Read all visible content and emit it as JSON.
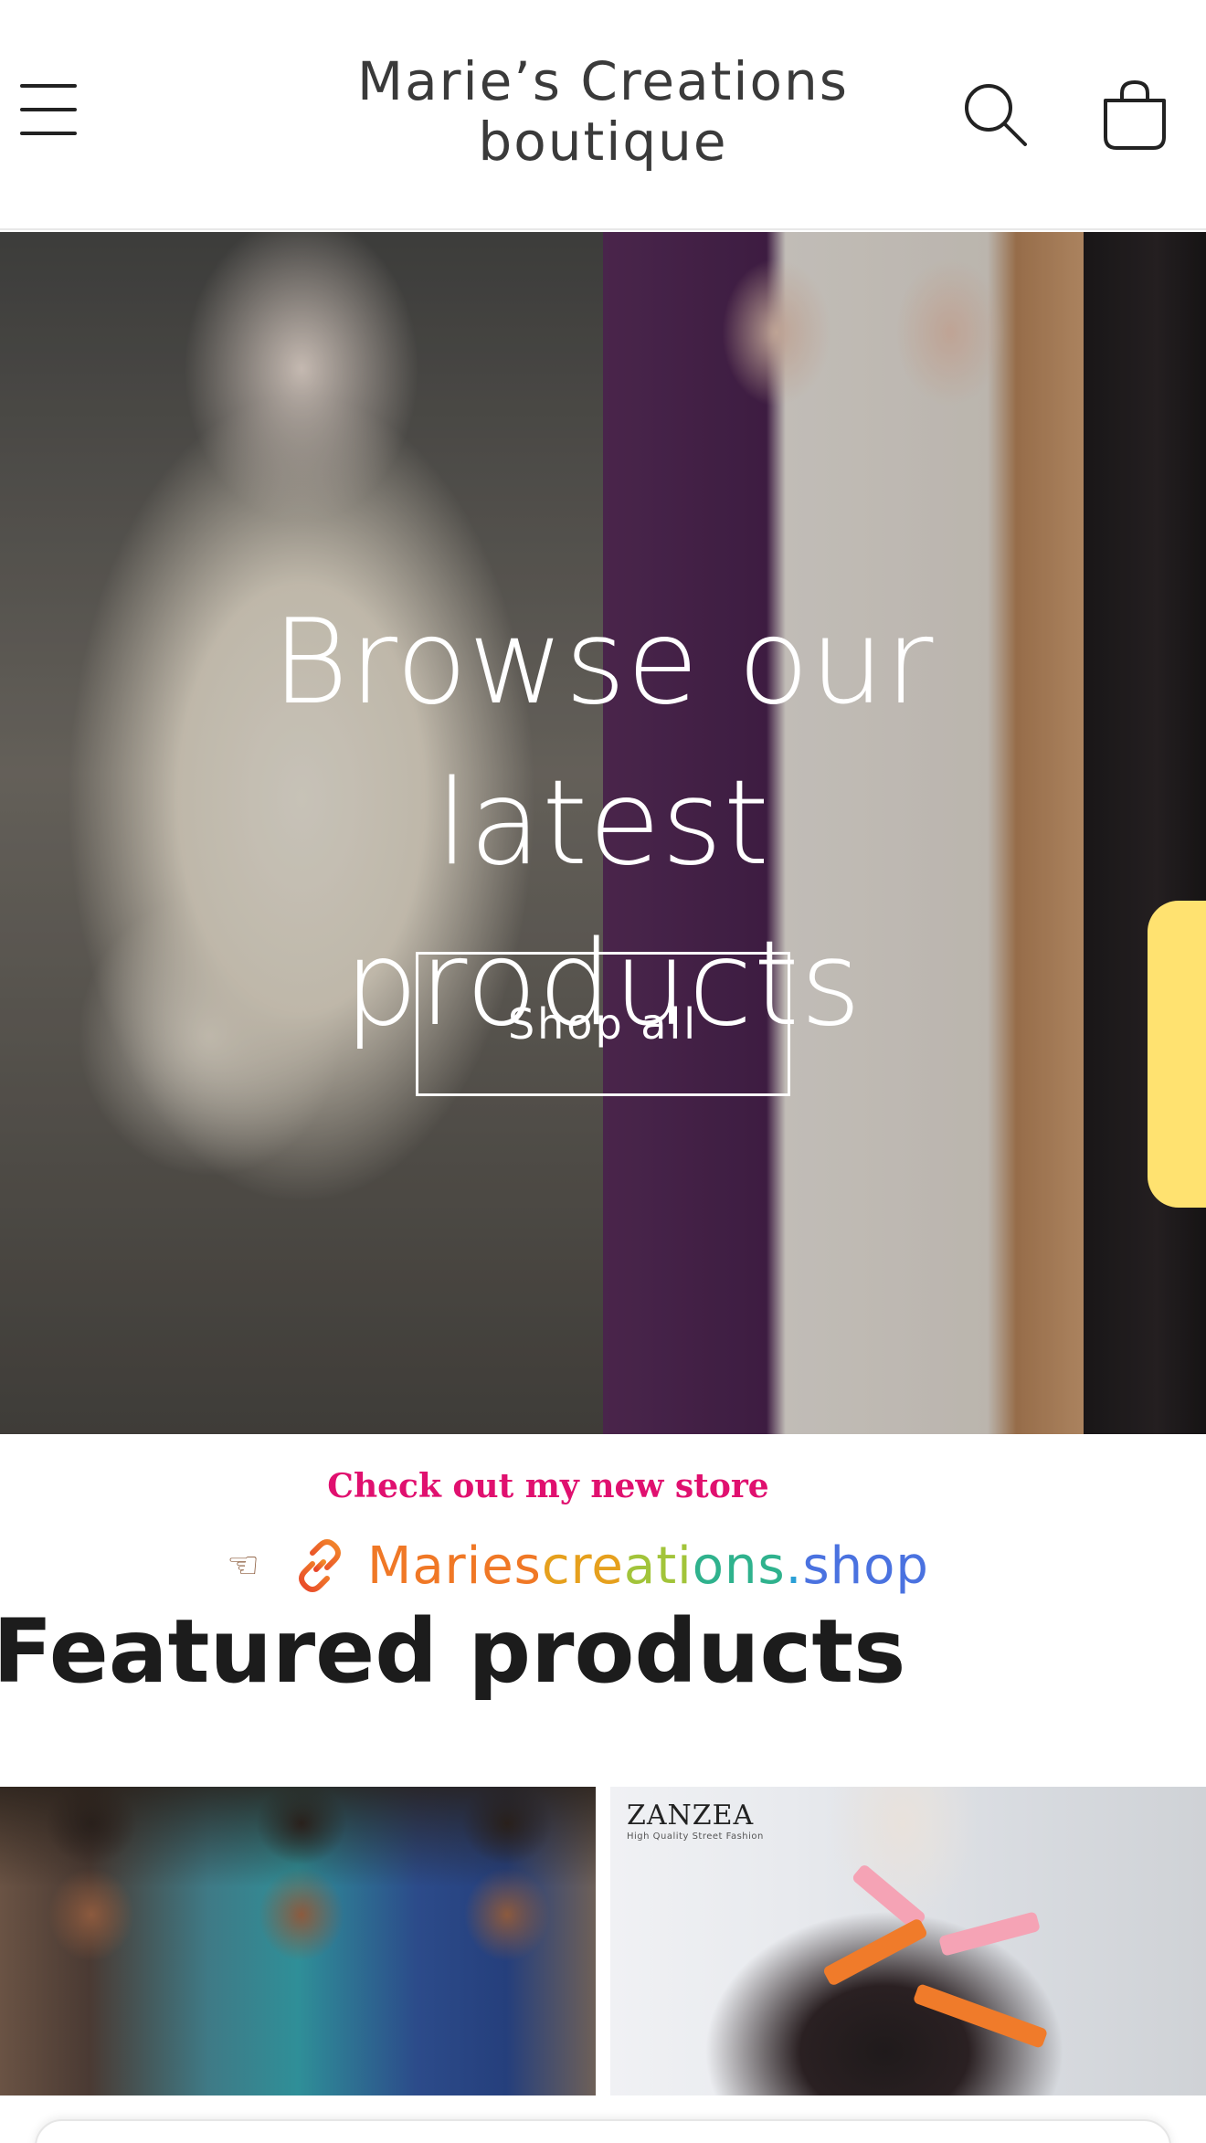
{
  "header": {
    "brand_line1": "Marie’s Creations",
    "brand_line2": "boutique",
    "icons": {
      "menu": "menu-icon",
      "search": "search-icon",
      "cart": "cart-icon"
    }
  },
  "hero": {
    "title_line1": "Browse our latest",
    "title_line2": "products",
    "button_label": "Shop all"
  },
  "promo": {
    "headline": "Check out my new store",
    "icons": {
      "hand": "pointing-hand-icon",
      "link": "link-icon"
    },
    "link_parts": [
      "Maries",
      "cre",
      "ati",
      "ons",
      ".",
      "shop"
    ]
  },
  "featured": {
    "title": "Featured products",
    "product_2_brand": "ZANZEA",
    "product_2_tagline": "High Quality Street Fashion"
  },
  "colors": {
    "promo_pink": "#e0106f",
    "side_tab_yellow": "#ffe270",
    "link_orange": "#f07826",
    "link_blue": "#4a72e0"
  }
}
